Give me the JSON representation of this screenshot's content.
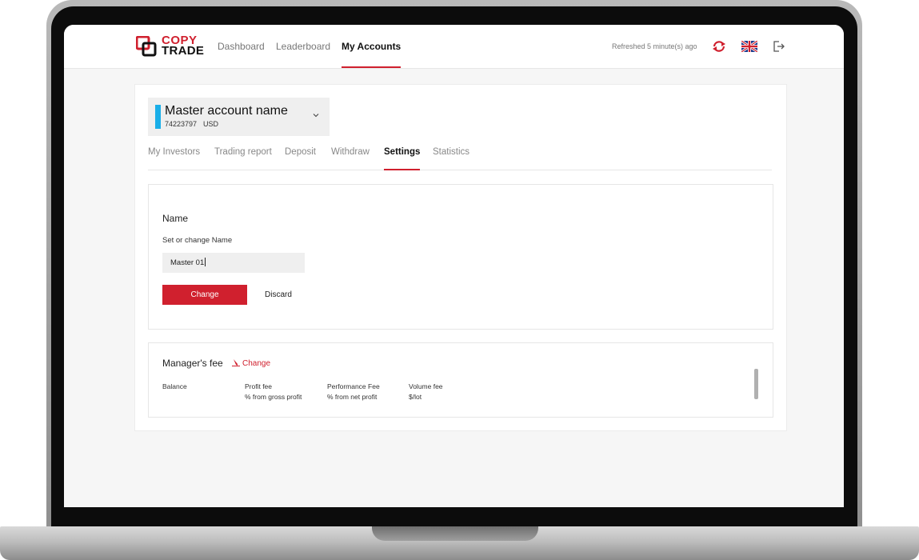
{
  "brand": {
    "logo_line1": "COPY",
    "logo_line2": "TRADE"
  },
  "nav": [
    {
      "label": "Dashboard"
    },
    {
      "label": "Leaderboard"
    },
    {
      "label": "My Accounts",
      "active": true
    }
  ],
  "header": {
    "refreshed_text": "Refreshed 5 minute(s) ago",
    "icons": [
      "refresh-icon",
      "uk-flag-icon",
      "logout-icon"
    ]
  },
  "account": {
    "name": "Master account name",
    "number": "74223797",
    "currency": "USD"
  },
  "tabs": [
    {
      "label": "My Investors"
    },
    {
      "label": "Trading report"
    },
    {
      "label": "Deposit"
    },
    {
      "label": "Withdraw"
    },
    {
      "label": "Settings",
      "active": true
    },
    {
      "label": "Statistics"
    }
  ],
  "name_section": {
    "title": "Name",
    "subtitle": "Set or change Name",
    "input_value": "Master 01",
    "change_label": "Change",
    "discard_label": "Discard"
  },
  "fee_section": {
    "title": "Manager's fee",
    "change_label": "Change",
    "columns": [
      {
        "header": "Balance",
        "sub": ""
      },
      {
        "header": "Profit fee",
        "sub": "% from gross profit"
      },
      {
        "header": "Performance Fee",
        "sub": "% from net profit"
      },
      {
        "header": "Volume fee",
        "sub": "$/lot"
      }
    ]
  },
  "colors": {
    "accent": "#d0202e",
    "account_marker": "#19aee8",
    "background": "#f6f6f6"
  }
}
